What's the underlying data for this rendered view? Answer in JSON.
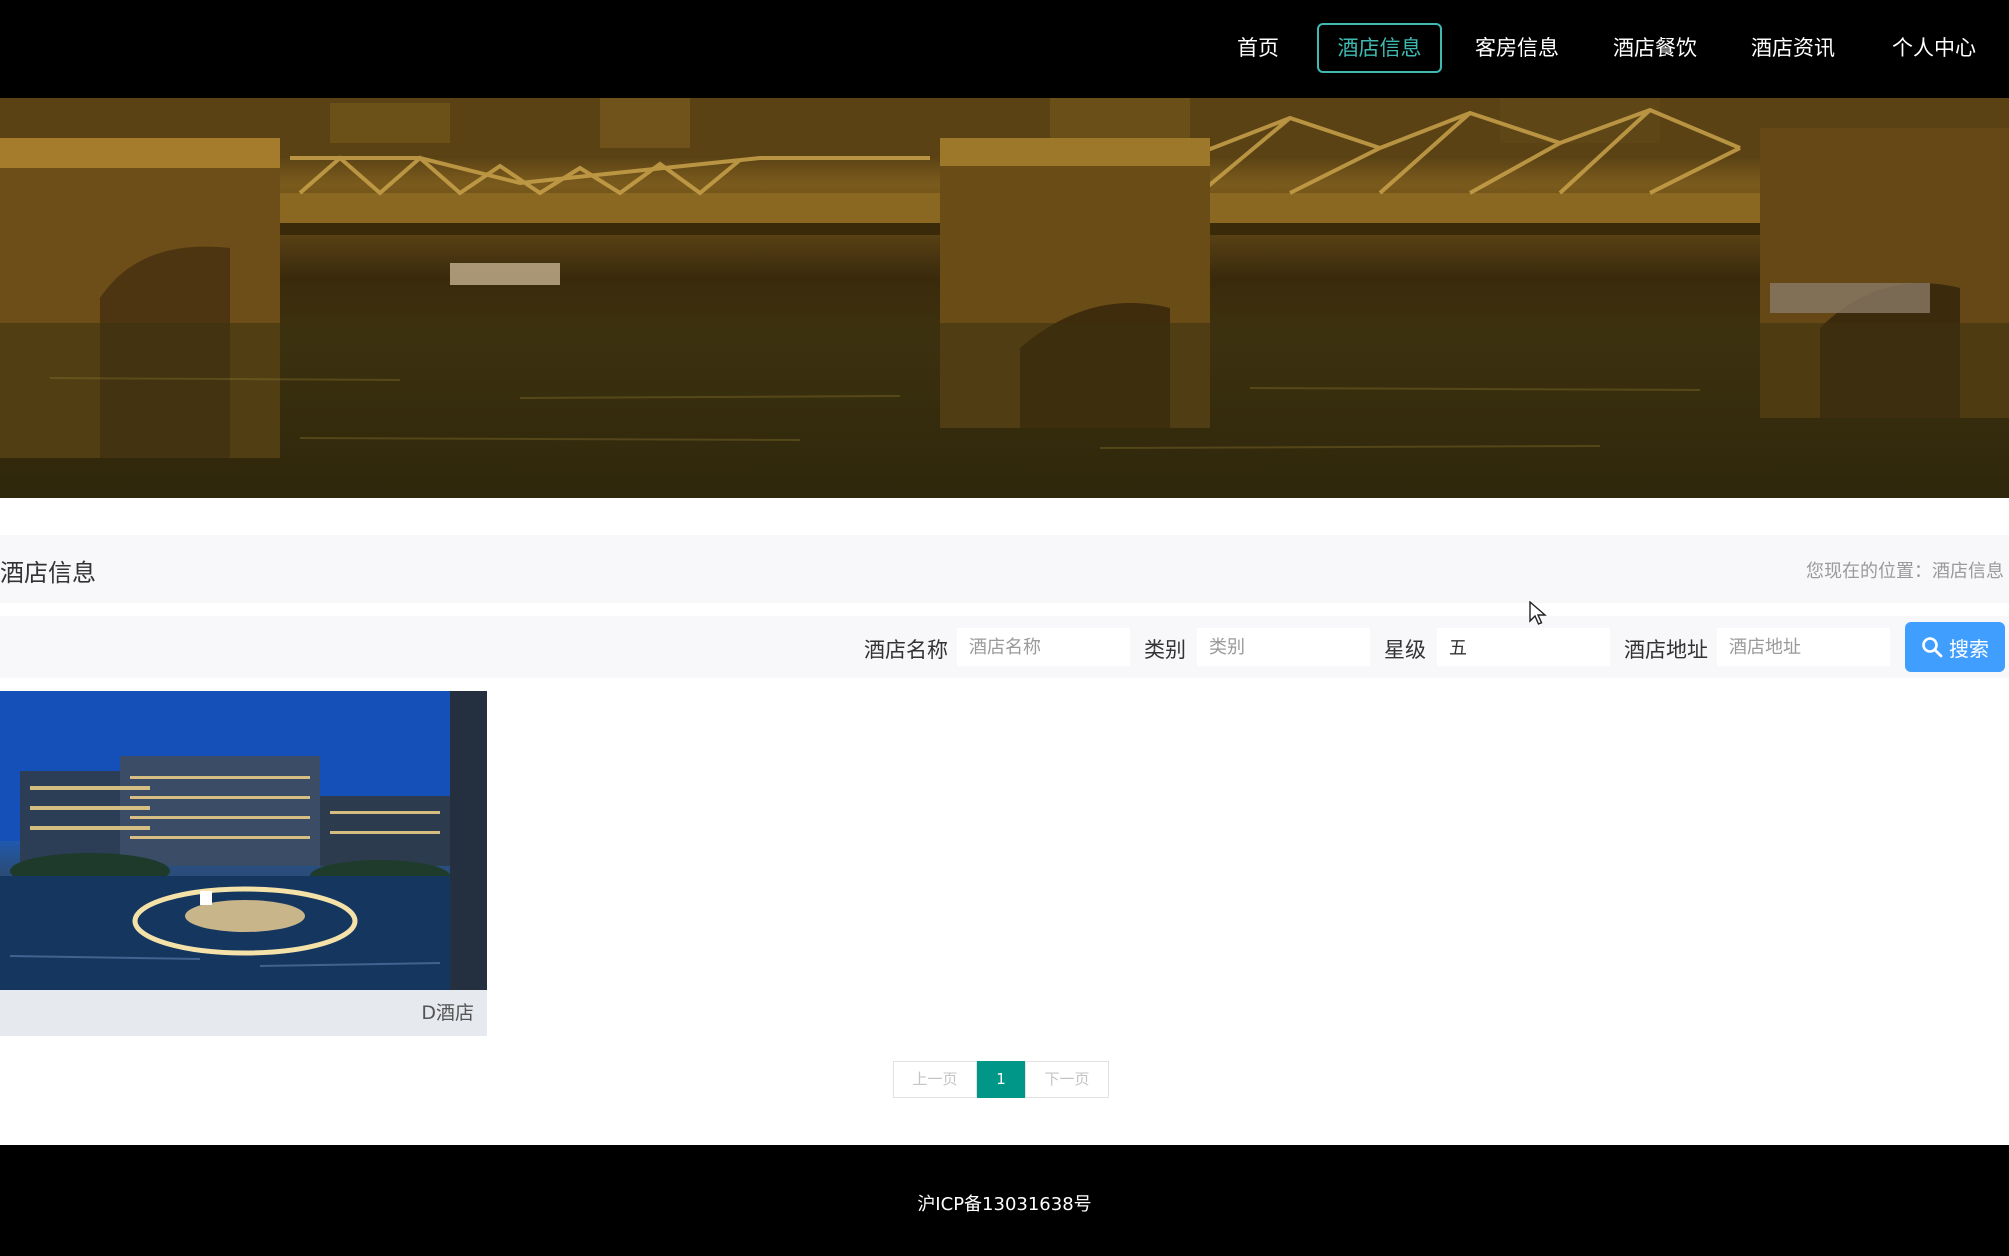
{
  "nav": {
    "items": [
      {
        "label": "首页",
        "active": false
      },
      {
        "label": "酒店信息",
        "active": true
      },
      {
        "label": "客房信息",
        "active": false
      },
      {
        "label": "酒店餐饮",
        "active": false
      },
      {
        "label": "酒店资讯",
        "active": false
      },
      {
        "label": "个人中心",
        "active": false
      }
    ],
    "accent_color": "#3fb9b1"
  },
  "carousel": {
    "slide_count": 3,
    "active_index": 1
  },
  "section": {
    "title": "酒店信息",
    "breadcrumb": "您现在的位置：酒店信息"
  },
  "search": {
    "fields": [
      {
        "label": "酒店名称",
        "placeholder": "酒店名称",
        "value": ""
      },
      {
        "label": "类别",
        "placeholder": "类别",
        "value": ""
      },
      {
        "label": "星级",
        "placeholder": "星级",
        "value": "五"
      },
      {
        "label": "酒店地址",
        "placeholder": "酒店地址",
        "value": ""
      }
    ],
    "button_label": "搜索",
    "button_icon": "search-icon",
    "button_color": "#409eff"
  },
  "cards": [
    {
      "title": "D酒店"
    }
  ],
  "pagination": {
    "prev_label": "上一页",
    "current_page": "1",
    "next_label": "下一页",
    "active_color": "#009688"
  },
  "footer": {
    "text": "沪ICP备13031638号"
  }
}
